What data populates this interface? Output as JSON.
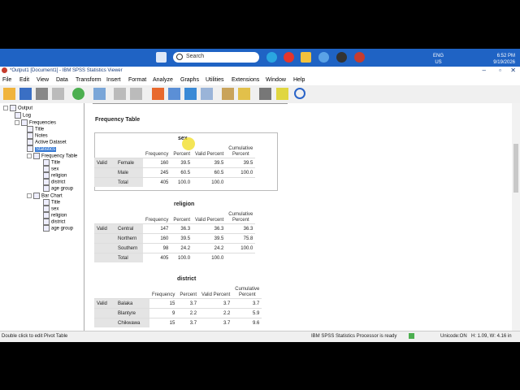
{
  "taskbar": {
    "search_placeholder": "Search",
    "lang1": "ENG",
    "lang2": "US",
    "time": "6:52 PM",
    "date": "9/19/2026"
  },
  "window": {
    "title": "*Output1 [Document1] - IBM SPSS Statistics Viewer"
  },
  "menu": [
    "File",
    "Edit",
    "View",
    "Data",
    "Transform",
    "Insert",
    "Format",
    "Analyze",
    "Graphs",
    "Utilities",
    "Extensions",
    "Window",
    "Help"
  ],
  "nav": {
    "output": "Output",
    "log": "Log",
    "frequencies": "Frequencies",
    "title": "Title",
    "notes": "Notes",
    "active_dataset": "Active Dataset",
    "statistics": "Statistics",
    "frequency_table": "Frequency Table",
    "ft_title": "Title",
    "sex": "sex",
    "religion": "religion",
    "district": "district",
    "age_group": "age group",
    "bar_chart": "Bar Chart",
    "bc_title": "Title",
    "bc_sex": "sex",
    "bc_religion": "religion",
    "bc_district": "district",
    "bc_age_group": "age group"
  },
  "content": {
    "heading": "Frequency Table",
    "headers": {
      "frequency": "Frequency",
      "percent": "Percent",
      "valid_percent": "Valid Percent",
      "cumulative1": "Cumulative",
      "cumulative2": "Percent"
    },
    "valid_label": "Valid",
    "total_label": "Total",
    "sex": {
      "title": "sex",
      "rows": [
        {
          "label": "Female",
          "freq": "160",
          "pct": "39.5",
          "vpct": "39.5",
          "cpct": "39.5"
        },
        {
          "label": "Male",
          "freq": "245",
          "pct": "60.5",
          "vpct": "60.5",
          "cpct": "100.0"
        }
      ],
      "total": {
        "freq": "405",
        "pct": "100.0",
        "vpct": "100.0"
      }
    },
    "religion": {
      "title": "religion",
      "rows": [
        {
          "label": "Central",
          "freq": "147",
          "pct": "36.3",
          "vpct": "36.3",
          "cpct": "36.3"
        },
        {
          "label": "Northern",
          "freq": "160",
          "pct": "39.5",
          "vpct": "39.5",
          "cpct": "75.8"
        },
        {
          "label": "Southern",
          "freq": "98",
          "pct": "24.2",
          "vpct": "24.2",
          "cpct": "100.0"
        }
      ],
      "total": {
        "freq": "405",
        "pct": "100.0",
        "vpct": "100.0"
      }
    },
    "district": {
      "title": "district",
      "rows": [
        {
          "label": "Balaka",
          "freq": "15",
          "pct": "3.7",
          "vpct": "3.7",
          "cpct": "3.7"
        },
        {
          "label": "Blantyre",
          "freq": "9",
          "pct": "2.2",
          "vpct": "2.2",
          "cpct": "5.9"
        },
        {
          "label": "Chikwawa",
          "freq": "15",
          "pct": "3.7",
          "vpct": "3.7",
          "cpct": "9.6"
        }
      ]
    }
  },
  "status": {
    "left": "Double click to edit Pivot Table",
    "processor": "IBM SPSS Statistics Processor is ready",
    "unicode": "Unicode:ON",
    "dims": "H: 1.09, W: 4.16 in"
  }
}
